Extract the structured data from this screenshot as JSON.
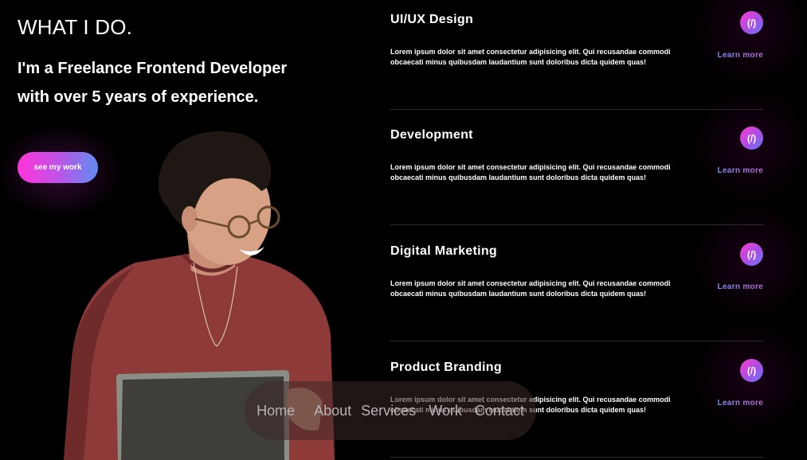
{
  "hero": {
    "heading": "WHAT I DO.",
    "tagline": "I'm a Freelance Frontend Developer with over 5 years of experience.",
    "cta_label": "see my work"
  },
  "services": [
    {
      "title": "UI/UX Design",
      "badge": "(/)",
      "description": "Lorem ipsum dolor sit amet consectetur adipisicing elit. Qui recusandae commodi obcaecati minus quibusdam laudantium sunt doloribus dicta quidem quas!",
      "link": "Learn more"
    },
    {
      "title": "Development",
      "badge": "(/)",
      "description": "Lorem ipsum dolor sit amet consectetur adipisicing elit. Qui recusandae commodi obcaecati minus quibusdam laudantium sunt doloribus dicta quidem quas!",
      "link": "Learn more"
    },
    {
      "title": "Digital Marketing",
      "badge": "(/)",
      "description": "Lorem ipsum dolor sit amet consectetur adipisicing elit. Qui recusandae commodi obcaecati minus quibusdam laudantium sunt doloribus dicta quidem quas!",
      "link": "Learn more"
    },
    {
      "title": "Product Branding",
      "badge": "(/)",
      "description": "Lorem ipsum dolor sit amet consectetur adipisicing elit. Qui recusandae commodi obcaecati minus quibusdam laudantium sunt doloribus dicta quidem quas!",
      "link": "Learn more"
    }
  ],
  "nav": {
    "items": [
      "Home",
      "About",
      "Services",
      "Work",
      "Contact"
    ]
  },
  "colors": {
    "background": "#000000",
    "accent_pink": "#ff34d8",
    "accent_blue": "#5f8df0",
    "sweater": "#8e3a38"
  }
}
